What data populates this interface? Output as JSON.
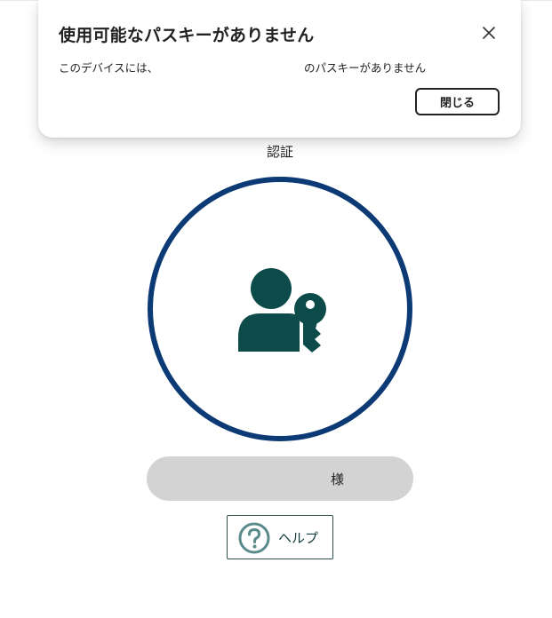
{
  "toast": {
    "title": "使用可能なパスキーがありません",
    "message_left": "このデバイスには、",
    "message_right": "のパスキーがありません",
    "close_button_label": "閉じる",
    "close_icon": "close-icon"
  },
  "main": {
    "title": "認証",
    "passkey_icon": "user-key-icon",
    "user_suffix": "様",
    "help_label": "ヘルプ",
    "help_icon": "question-circle-icon"
  },
  "colors": {
    "circle_ring": "#0b3a75",
    "icon_fill": "#0d4a4a",
    "user_bar_bg": "#d3d3d3",
    "help_icon": "#5b8a8a"
  }
}
